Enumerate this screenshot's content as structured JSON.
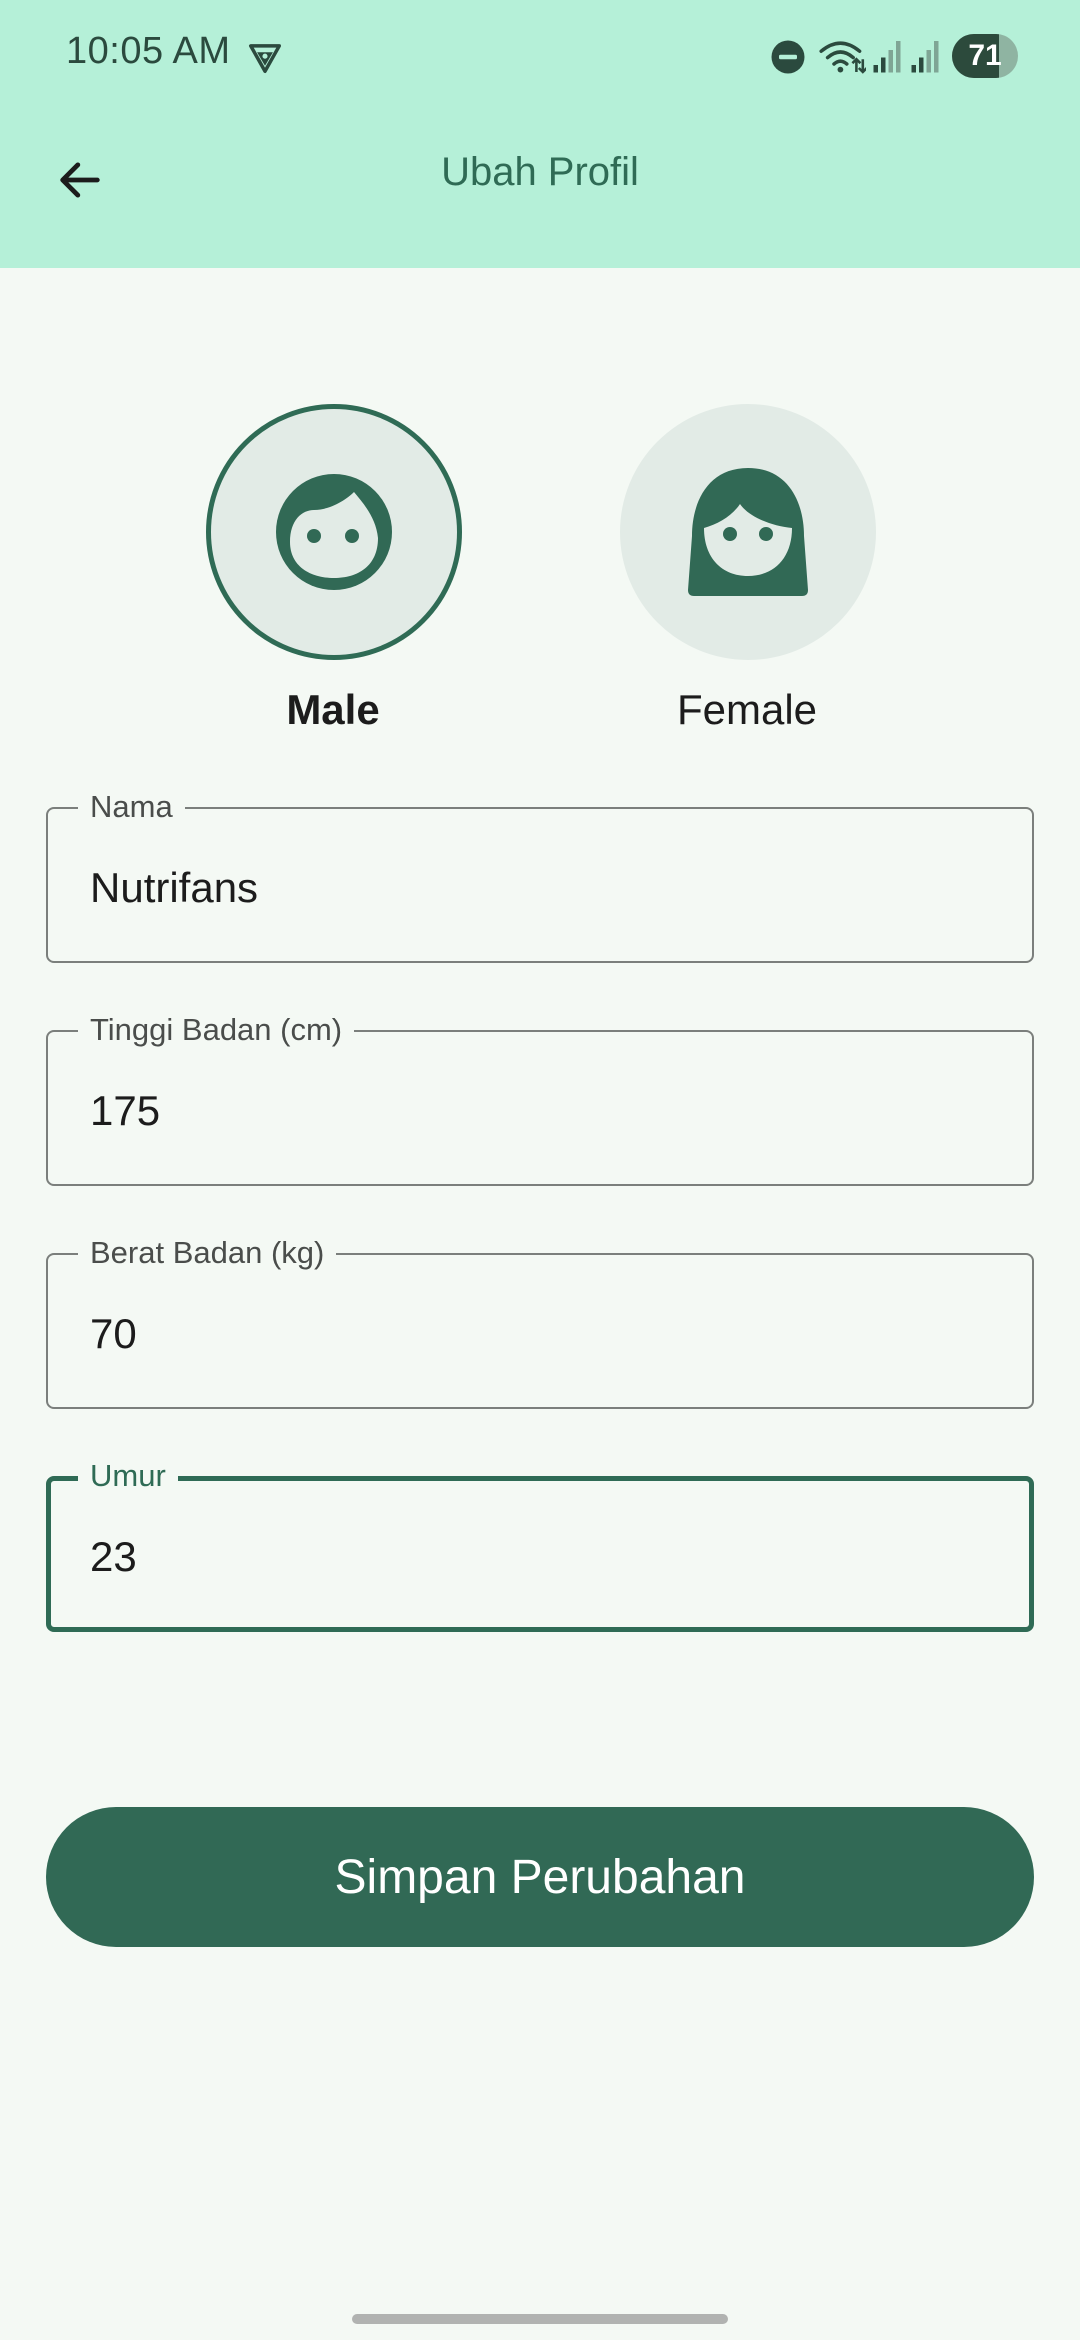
{
  "status_bar": {
    "time": "10:05 AM",
    "battery_level": "71",
    "icons": [
      "vpn-icon",
      "dnd-icon",
      "wifi-icon",
      "signal-icon",
      "signal-icon",
      "battery-icon"
    ]
  },
  "header": {
    "title": "Ubah Profil",
    "back_icon": "arrow-left-icon"
  },
  "gender": {
    "selected": "male",
    "options": [
      {
        "id": "male",
        "label": "Male",
        "icon": "male-face-icon"
      },
      {
        "id": "female",
        "label": "Female",
        "icon": "female-face-icon"
      }
    ]
  },
  "form": {
    "fields": [
      {
        "label": "Nama",
        "value": "Nutrifans",
        "focused": false
      },
      {
        "label": "Tinggi Badan (cm)",
        "value": "175",
        "focused": false
      },
      {
        "label": "Berat Badan (kg)",
        "value": "70",
        "focused": false
      },
      {
        "label": "Umur",
        "value": "23",
        "focused": true
      }
    ]
  },
  "actions": {
    "save_label": "Simpan Perubahan"
  },
  "colors": {
    "header_bg": "#b5f0d8",
    "primary": "#316955",
    "page_bg": "#f4f9f4",
    "avatar_bg": "#e2ebe6"
  }
}
